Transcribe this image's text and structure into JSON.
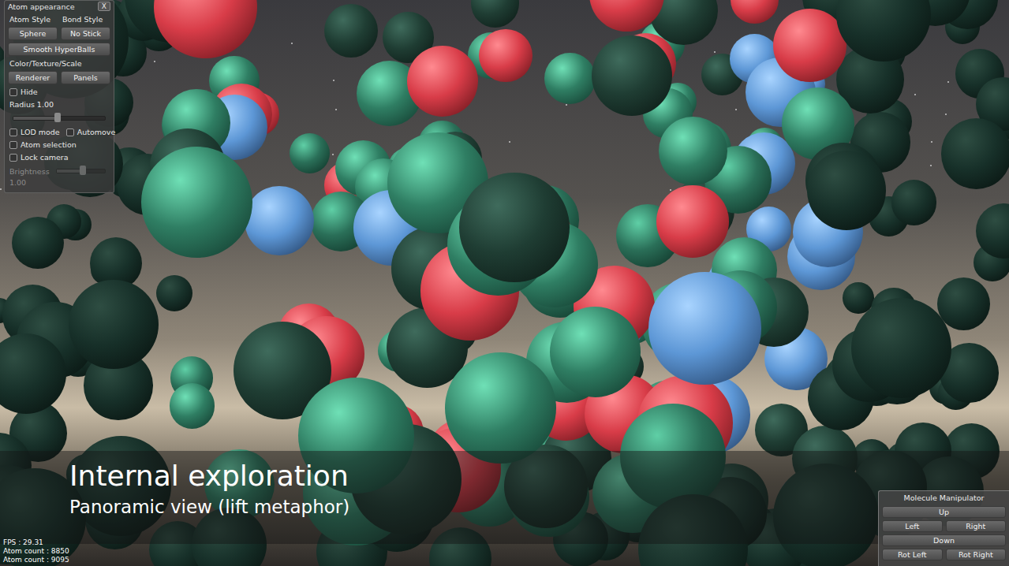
{
  "panel": {
    "title": "Atom appearance",
    "close": "X",
    "style_headers": [
      "Atom Style",
      "Bond Style"
    ],
    "style_buttons": [
      "Sphere",
      "No Stick"
    ],
    "wide_button": "Smooth HyperBalls",
    "section": "Color/Texture/Scale",
    "section_buttons": [
      "Renderer",
      "Panels"
    ],
    "hide": {
      "label": "Hide",
      "checked": false
    },
    "radius": {
      "label": "Radius 1.00",
      "level": 0.48
    },
    "options": [
      [
        {
          "label": "LOD mode",
          "checked": false
        },
        {
          "label": "Automove",
          "checked": false
        }
      ],
      [
        {
          "label": "Atom selection",
          "checked": false
        }
      ],
      [
        {
          "label": "Lock camera",
          "checked": false
        }
      ]
    ],
    "brightness": {
      "label": "Brightness",
      "reading": "1.00",
      "level": 0.55,
      "disabled": true
    }
  },
  "caption": {
    "title": "Internal exploration",
    "subtitle": "Panoramic view (lift metaphor)"
  },
  "stats": [
    "FPS : 29.31",
    "Atom count : 8850",
    "Atom count : 9095"
  ],
  "manipulator": {
    "title": "Molecule Manipulator",
    "rows": [
      [
        "Up"
      ],
      [
        "Left",
        "Right"
      ],
      [
        "Down"
      ],
      [
        "Rot Left",
        "Rot Right"
      ]
    ]
  }
}
